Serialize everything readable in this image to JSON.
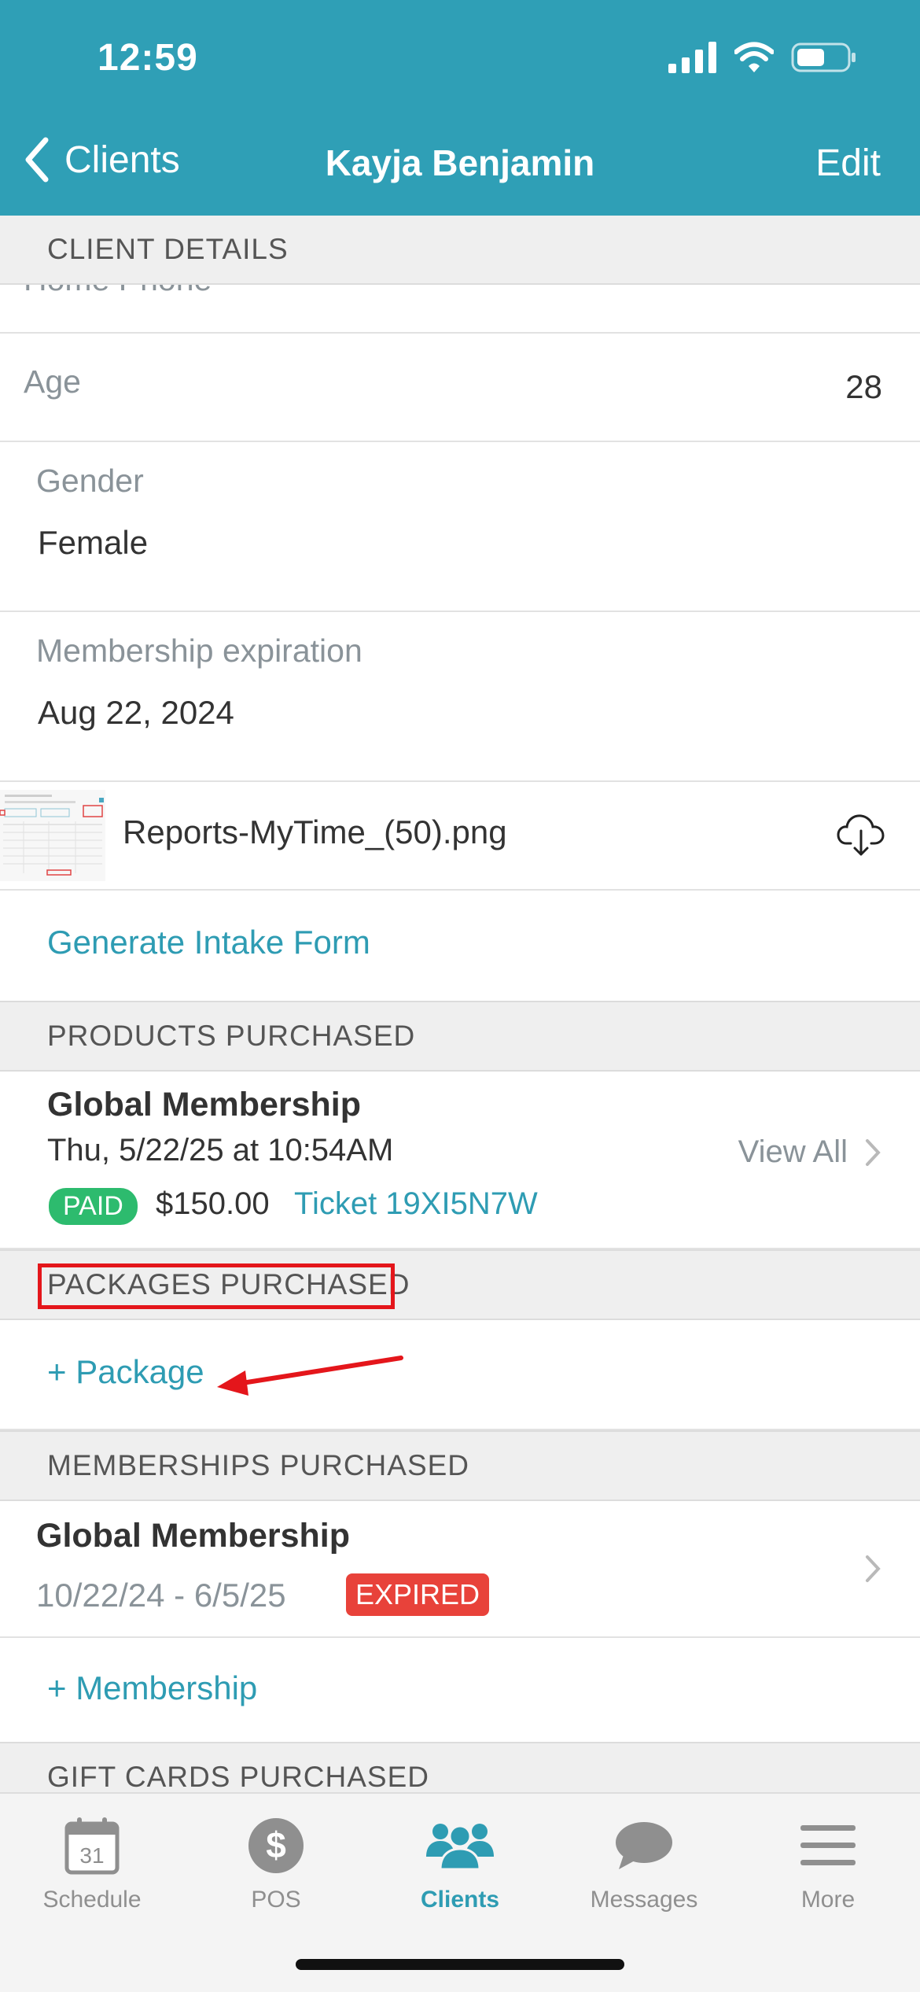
{
  "status": {
    "time": "12:59"
  },
  "nav": {
    "back_label": "Clients",
    "title": "Kayja Benjamin",
    "edit_label": "Edit"
  },
  "sections": {
    "client_details": "CLIENT DETAILS",
    "products": "PRODUCTS PURCHASED",
    "packages": "PACKAGES PURCHASED",
    "memberships": "MEMBERSHIPS PURCHASED",
    "gift_cards": "GIFT CARDS PURCHASED"
  },
  "client": {
    "partial_label": "Home Phone",
    "age_label": "Age",
    "age_value": "28",
    "gender_label": "Gender",
    "gender_value": "Female",
    "membership_exp_label": "Membership expiration",
    "membership_exp_value": "Aug 22, 2024",
    "attachment_name": "Reports-MyTime_(50).png",
    "intake_form_link": "Generate Intake Form"
  },
  "product": {
    "name": "Global Membership",
    "date": "Thu, 5/22/25 at 10:54AM",
    "paid_badge": "PAID",
    "price": "$150.00",
    "ticket": "Ticket 19XI5N7W",
    "view_all": "View All"
  },
  "packages": {
    "add_link": "+ Package"
  },
  "membership": {
    "name": "Global Membership",
    "dates": "10/22/24 - 6/5/25",
    "expired_badge": "EXPIRED",
    "add_link": "+ Membership"
  },
  "tabs": [
    {
      "label": "Schedule",
      "icon": "calendar-icon",
      "calendar_day": "31"
    },
    {
      "label": "POS",
      "icon": "dollar-icon",
      "glyph": "$"
    },
    {
      "label": "Clients",
      "icon": "clients-icon"
    },
    {
      "label": "Messages",
      "icon": "chat-bubble-icon"
    },
    {
      "label": "More",
      "icon": "menu-icon"
    }
  ],
  "colors": {
    "header": "#2f9fb6",
    "accent": "#2e9cb3",
    "paid": "#2dbb6e",
    "expired": "#e8423a",
    "annotation": "#e4161b"
  }
}
